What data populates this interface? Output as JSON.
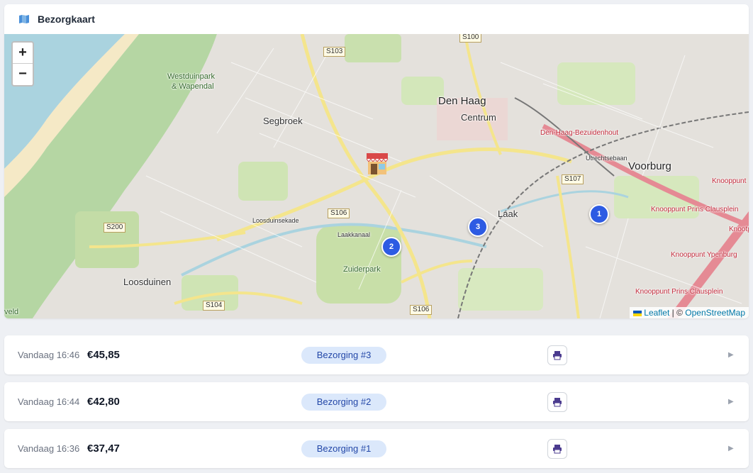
{
  "header": {
    "title": "Bezorgkaart",
    "icon": "map-icon"
  },
  "map": {
    "zoom_in": "+",
    "zoom_out": "−",
    "places": {
      "westduinpark_1": "Westduinpark",
      "westduinpark_2": "& Wapendal",
      "segbroek": "Segbroek",
      "den_haag": "Den Haag",
      "centrum": "Centrum",
      "voorburg": "Voorburg",
      "laak": "Laak",
      "loosduinen": "Loosduinen",
      "zuiderpark": "Zuiderpark",
      "bezuidenhout": "Den-Haag-Bezuidenhout",
      "knooppunt_1": "Knooppunt Prins Clausplein",
      "knooppunt_2": "Knooppunt Ypenburg",
      "knooppunt_3": "Knooppunt Prins Clausplein",
      "knooppunt_edge": "Knooppunt",
      "knooppunt_edge2": "Knootp",
      "veld": "veld",
      "loosduinsekade": "Loosduinsekade",
      "laakkanaal": "Laakkanaal",
      "utrechtsebaan": "Utrechtsebaan"
    },
    "shields": {
      "s100": "S100",
      "s103": "S103",
      "s106a": "S106",
      "s106b": "S106",
      "s107": "S107",
      "s200": "S200",
      "s104": "S104"
    },
    "markers": {
      "m1": "1",
      "m2": "2",
      "m3": "3"
    },
    "attribution": {
      "leaflet": "Leaflet",
      "separator": " | © ",
      "osm": "OpenStreetMap"
    }
  },
  "deliveries": [
    {
      "time": "Vandaag 16:46",
      "amount": "€45,85",
      "label": "Bezorging #3",
      "print_icon": "printer-icon",
      "chevron": "▶"
    },
    {
      "time": "Vandaag 16:44",
      "amount": "€42,80",
      "label": "Bezorging #2",
      "print_icon": "printer-icon",
      "chevron": "▶"
    },
    {
      "time": "Vandaag 16:36",
      "amount": "€37,47",
      "label": "Bezorging #1",
      "print_icon": "printer-icon",
      "chevron": "▶"
    }
  ],
  "colors": {
    "accent": "#2d5be3",
    "pill_bg": "#dbe8fb",
    "pill_text": "#2448a8",
    "page_bg": "#eef0f4"
  }
}
